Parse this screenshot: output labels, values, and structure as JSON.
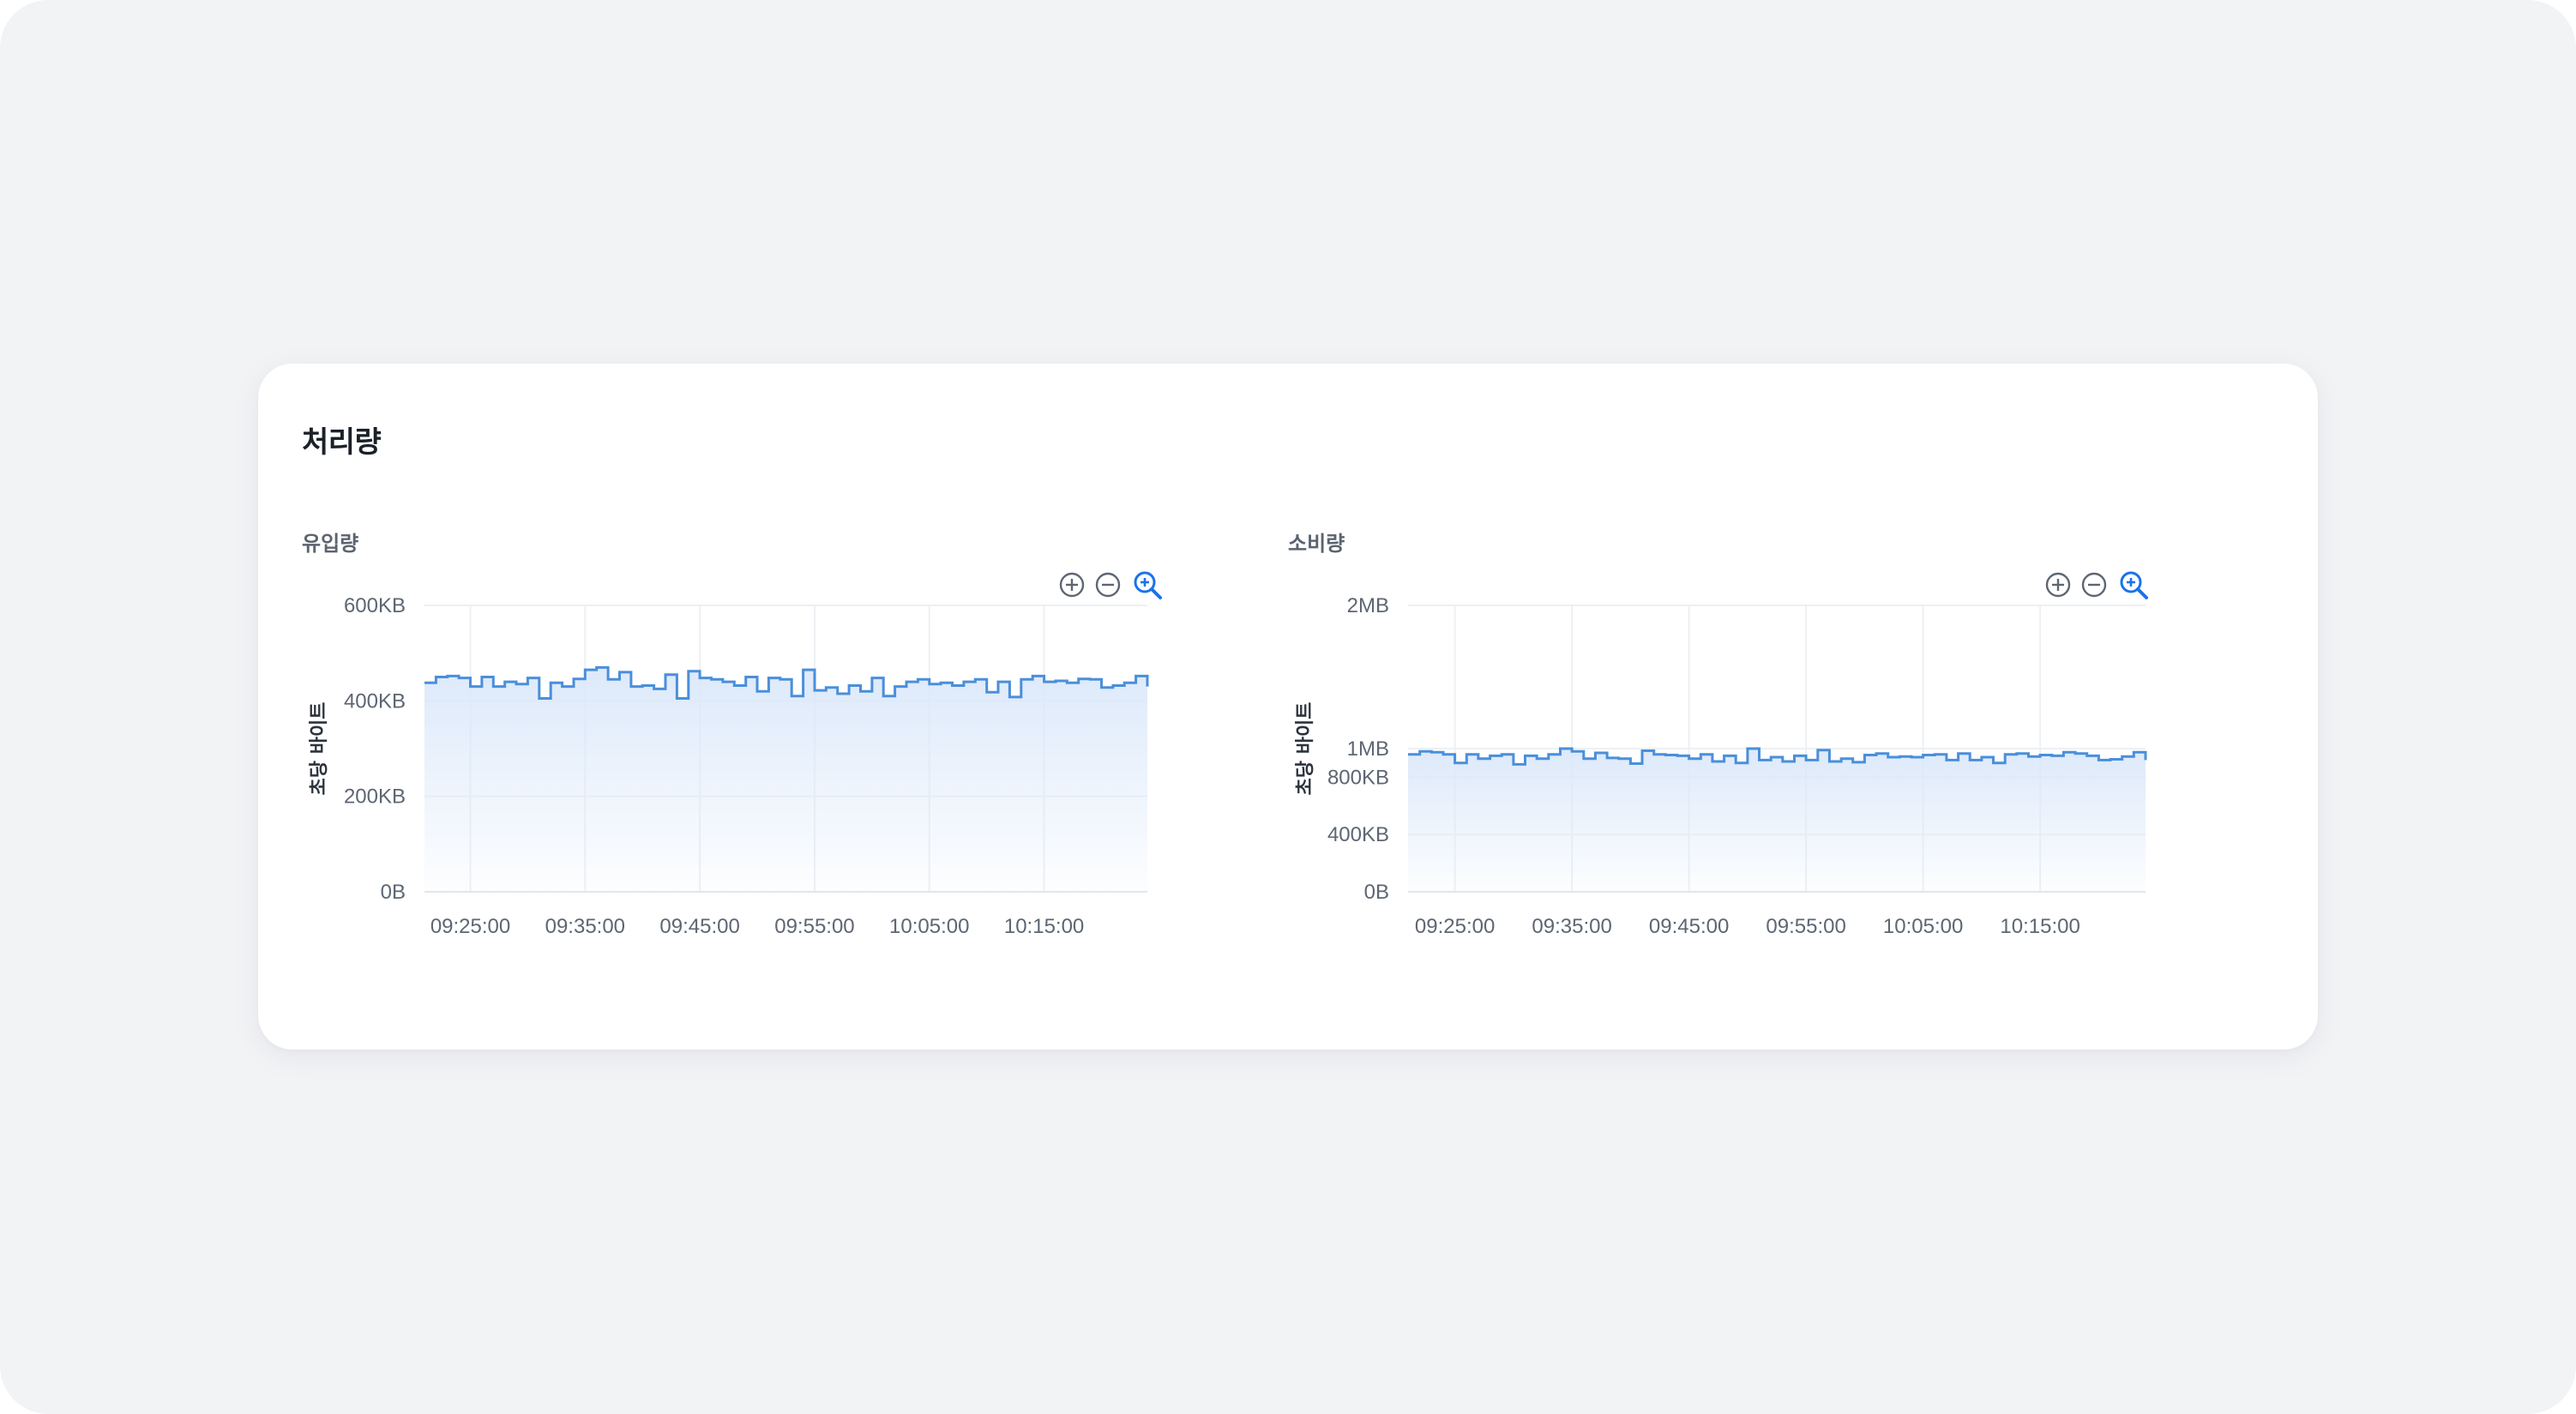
{
  "card": {
    "title": "처리량"
  },
  "colors": {
    "line": "#4a8fdb",
    "area_top": "#dbe8fa",
    "grid": "#edf0f4",
    "zoom_active": "#1a73e8",
    "zoom_muted": "#5d6673"
  },
  "icons": {
    "zoom_in": "plus-circle-icon",
    "zoom_out": "minus-circle-icon",
    "zoom_select": "magnifier-plus-icon"
  },
  "chart_data": [
    {
      "type": "area",
      "title": "유입량",
      "xlabel": "",
      "ylabel": "초당 바이트",
      "y_unit": "KB",
      "yticks": [
        0,
        200,
        400,
        600
      ],
      "ytick_labels": [
        "0B",
        "200KB",
        "400KB",
        "600KB"
      ],
      "ylim": [
        0,
        600
      ],
      "x_range": [
        "09:21:00",
        "10:24:00"
      ],
      "xticks": [
        "09:25:00",
        "09:35:00",
        "09:45:00",
        "09:55:00",
        "10:05:00",
        "10:15:00"
      ],
      "grid": true,
      "step": true,
      "series": [
        {
          "x": [
            "09:21:00",
            "09:22:00",
            "09:23:00",
            "09:24:00",
            "09:25:00",
            "09:26:00",
            "09:27:00",
            "09:28:00",
            "09:29:00",
            "09:30:00",
            "09:31:00",
            "09:32:00",
            "09:33:00",
            "09:34:00",
            "09:35:00",
            "09:36:00",
            "09:37:00",
            "09:38:00",
            "09:39:00",
            "09:40:00",
            "09:41:00",
            "09:42:00",
            "09:43:00",
            "09:44:00",
            "09:45:00",
            "09:46:00",
            "09:47:00",
            "09:48:00",
            "09:49:00",
            "09:50:00",
            "09:51:00",
            "09:52:00",
            "09:53:00",
            "09:54:00",
            "09:55:00",
            "09:56:00",
            "09:57:00",
            "09:58:00",
            "09:59:00",
            "10:00:00",
            "10:01:00",
            "10:02:00",
            "10:03:00",
            "10:04:00",
            "10:05:00",
            "10:06:00",
            "10:07:00",
            "10:08:00",
            "10:09:00",
            "10:10:00",
            "10:11:00",
            "10:12:00",
            "10:13:00",
            "10:14:00",
            "10:15:00",
            "10:16:00",
            "10:17:00",
            "10:18:00",
            "10:19:00",
            "10:20:00",
            "10:21:00",
            "10:22:00",
            "10:23:00",
            "10:24:00"
          ],
          "y": [
            438,
            450,
            452,
            448,
            430,
            450,
            430,
            440,
            435,
            448,
            405,
            438,
            430,
            446,
            465,
            470,
            445,
            460,
            430,
            432,
            425,
            455,
            405,
            462,
            448,
            445,
            440,
            432,
            450,
            420,
            448,
            445,
            410,
            465,
            422,
            428,
            415,
            432,
            420,
            448,
            410,
            430,
            440,
            445,
            435,
            438,
            432,
            440,
            445,
            418,
            440,
            408,
            445,
            452,
            440,
            442,
            438,
            446,
            445,
            428,
            432,
            438,
            452,
            430
          ]
        }
      ]
    },
    {
      "type": "area",
      "title": "소비량",
      "xlabel": "",
      "ylabel": "초당 바이트",
      "y_unit": "KB",
      "yticks": [
        0,
        400,
        800,
        1000,
        2000
      ],
      "ytick_labels": [
        "0B",
        "400KB",
        "800KB",
        "1MB",
        "2MB"
      ],
      "ylim": [
        0,
        2000
      ],
      "x_range": [
        "09:21:00",
        "10:24:00"
      ],
      "xticks": [
        "09:25:00",
        "09:35:00",
        "09:45:00",
        "09:55:00",
        "10:05:00",
        "10:15:00"
      ],
      "grid": true,
      "step": true,
      "series": [
        {
          "x": [
            "09:21:00",
            "09:22:00",
            "09:23:00",
            "09:24:00",
            "09:25:00",
            "09:26:00",
            "09:27:00",
            "09:28:00",
            "09:29:00",
            "09:30:00",
            "09:31:00",
            "09:32:00",
            "09:33:00",
            "09:34:00",
            "09:35:00",
            "09:36:00",
            "09:37:00",
            "09:38:00",
            "09:39:00",
            "09:40:00",
            "09:41:00",
            "09:42:00",
            "09:43:00",
            "09:44:00",
            "09:45:00",
            "09:46:00",
            "09:47:00",
            "09:48:00",
            "09:49:00",
            "09:50:00",
            "09:51:00",
            "09:52:00",
            "09:53:00",
            "09:54:00",
            "09:55:00",
            "09:56:00",
            "09:57:00",
            "09:58:00",
            "09:59:00",
            "10:00:00",
            "10:01:00",
            "10:02:00",
            "10:03:00",
            "10:04:00",
            "10:05:00",
            "10:06:00",
            "10:07:00",
            "10:08:00",
            "10:09:00",
            "10:10:00",
            "10:11:00",
            "10:12:00",
            "10:13:00",
            "10:14:00",
            "10:15:00",
            "10:16:00",
            "10:17:00",
            "10:18:00",
            "10:19:00",
            "10:20:00",
            "10:21:00",
            "10:22:00",
            "10:23:00",
            "10:24:00"
          ],
          "y": [
            960,
            980,
            975,
            960,
            900,
            960,
            930,
            950,
            960,
            890,
            950,
            930,
            960,
            1000,
            980,
            930,
            970,
            935,
            930,
            895,
            985,
            960,
            955,
            950,
            930,
            960,
            910,
            950,
            900,
            1000,
            920,
            940,
            910,
            950,
            920,
            990,
            910,
            930,
            905,
            955,
            965,
            940,
            945,
            940,
            955,
            960,
            920,
            965,
            920,
            940,
            900,
            960,
            965,
            945,
            955,
            950,
            975,
            965,
            950,
            920,
            925,
            945,
            975,
            920
          ]
        }
      ]
    }
  ]
}
